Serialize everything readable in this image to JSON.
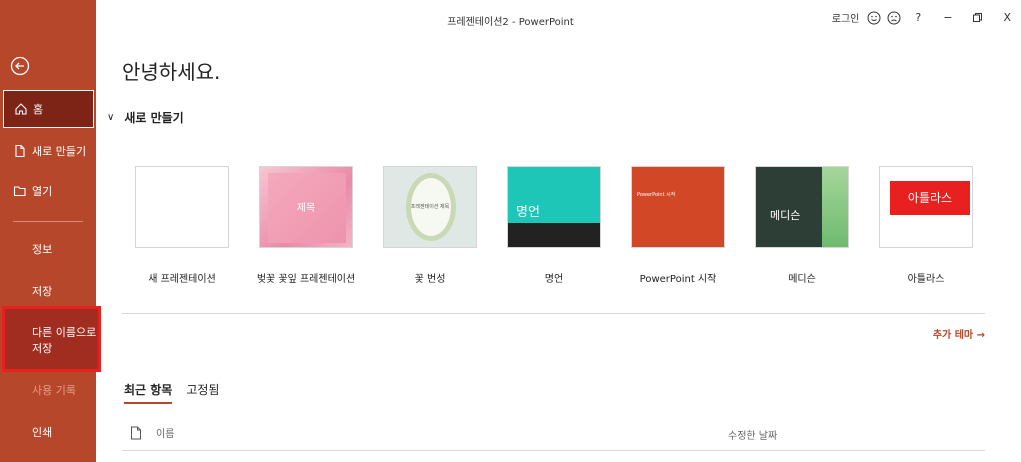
{
  "window": {
    "title": "프레젠테이션2  -  PowerPoint",
    "login": "로그인",
    "help": "?",
    "minimize": "−",
    "restore": "▫",
    "close": "X"
  },
  "sidebar": {
    "home": "홈",
    "new": "새로 만들기",
    "open": "열기",
    "info": "정보",
    "save": "저장",
    "save_as": "다른 이름으로 저장",
    "history": "사용 기록",
    "print": "인쇄"
  },
  "main": {
    "greeting": "안녕하세요.",
    "new_section": "새로 만들기",
    "more_themes": "추가 테마  →"
  },
  "templates": [
    {
      "label": "새 프레젠테이션",
      "thumb_text": ""
    },
    {
      "label": "벚꽃 꽃잎 프레젠테이션",
      "thumb_text": "제목"
    },
    {
      "label": "꽃 번성",
      "thumb_text": "프레젠테이션 제목"
    },
    {
      "label": "명언",
      "thumb_text": "명언"
    },
    {
      "label": "PowerPoint 시작",
      "thumb_text": "PowerPoint 시작"
    },
    {
      "label": "메디슨",
      "thumb_text": "메디슨"
    },
    {
      "label": "아틀라스",
      "thumb_text": "아틀라스"
    }
  ],
  "recent": {
    "tab_recent": "최근 항목",
    "tab_pinned": "고정됨",
    "col_name": "이름",
    "col_date": "수정한 날짜"
  },
  "colors": {
    "accent": "#b7472a",
    "home_selected": "#7d2417",
    "highlight_box": "#e8201f"
  }
}
